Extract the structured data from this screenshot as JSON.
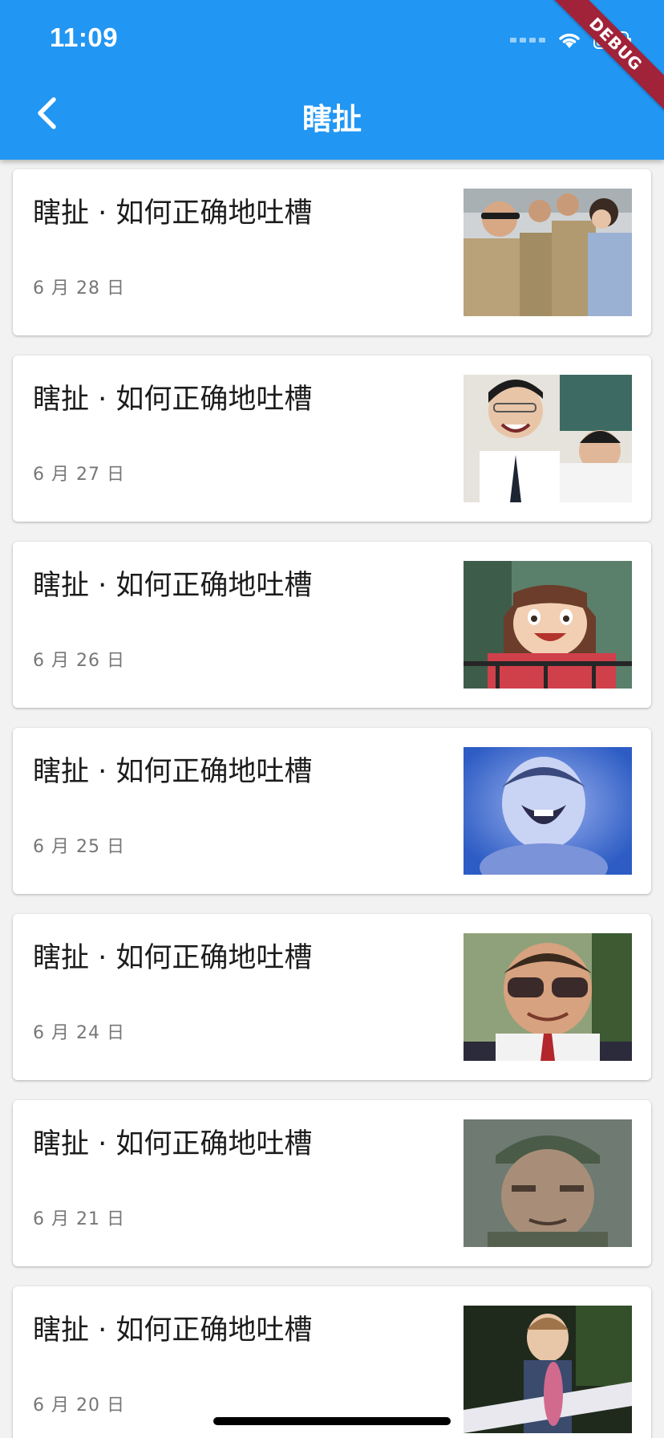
{
  "status_bar": {
    "time": "11:09"
  },
  "debug_banner": "DEBUG",
  "app_bar": {
    "title": "瞎扯",
    "back_icon": "chevron-left-icon"
  },
  "colors": {
    "primary": "#2196f3",
    "background": "#f2f2f2",
    "card": "#ffffff"
  },
  "articles": [
    {
      "title": "瞎扯 · 如何正确地吐槽",
      "date": "6 月 28 日",
      "thumbnail": "soldiers-photo"
    },
    {
      "title": "瞎扯 · 如何正确地吐槽",
      "date": "6 月 27 日",
      "thumbnail": "laughing-students-photo"
    },
    {
      "title": "瞎扯 · 如何正确地吐槽",
      "date": "6 月 26 日",
      "thumbnail": "anime-girl-photo"
    },
    {
      "title": "瞎扯 · 如何正确地吐槽",
      "date": "6 月 25 日",
      "thumbnail": "crying-boy-photo"
    },
    {
      "title": "瞎扯 · 如何正确地吐槽",
      "date": "6 月 24 日",
      "thumbnail": "sunglasses-kid-photo"
    },
    {
      "title": "瞎扯 · 如何正确地吐槽",
      "date": "6 月 21 日",
      "thumbnail": "old-soldier-photo"
    },
    {
      "title": "瞎扯 · 如何正确地吐槽",
      "date": "6 月 20 日",
      "thumbnail": "boy-with-plane-photo"
    }
  ]
}
